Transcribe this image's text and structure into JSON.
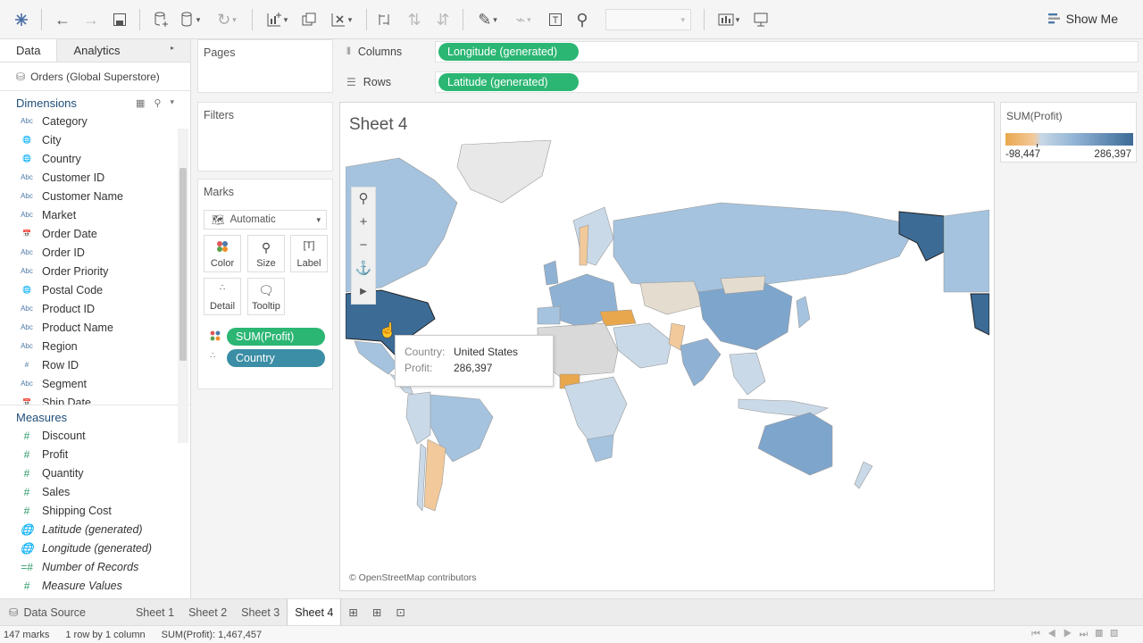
{
  "toolbar": {
    "show_me": "Show Me"
  },
  "data_pane": {
    "tab_data": "Data",
    "tab_analytics": "Analytics",
    "datasource": "Orders (Global Superstore)",
    "dimensions_title": "Dimensions",
    "dimensions": [
      "Category",
      "City",
      "Country",
      "Customer ID",
      "Customer Name",
      "Market",
      "Order Date",
      "Order ID",
      "Order Priority",
      "Postal Code",
      "Product ID",
      "Product Name",
      "Region",
      "Row ID",
      "Segment",
      "Ship Date"
    ],
    "measures_title": "Measures",
    "measures": [
      "Discount",
      "Profit",
      "Quantity",
      "Sales",
      "Shipping Cost",
      "Latitude (generated)",
      "Longitude (generated)",
      "Number of Records",
      "Measure Values"
    ]
  },
  "cards": {
    "pages": "Pages",
    "filters": "Filters",
    "marks": "Marks",
    "mark_type": "Automatic",
    "buttons": [
      "Color",
      "Size",
      "Label",
      "Detail",
      "Tooltip"
    ],
    "pill_profit": "SUM(Profit)",
    "pill_country": "Country"
  },
  "shelves": {
    "columns_label": "Columns",
    "columns_pill": "Longitude (generated)",
    "rows_label": "Rows",
    "rows_pill": "Latitude (generated)"
  },
  "view": {
    "title": "Sheet 4",
    "attribution": "© OpenStreetMap contributors",
    "tooltip_country_key": "Country:",
    "tooltip_country_val": "United States",
    "tooltip_profit_key": "Profit:",
    "tooltip_profit_val": "286,397"
  },
  "legend": {
    "title": "SUM(Profit)",
    "min": "-98,447",
    "max": "286,397",
    "colors": [
      "#e9a74d",
      "#c7d7e6",
      "#3c6b96"
    ]
  },
  "sheet_tabs": {
    "data_source": "Data Source",
    "tabs": [
      "Sheet 1",
      "Sheet 2",
      "Sheet 3",
      "Sheet 4"
    ]
  },
  "status": {
    "marks": "147 marks",
    "dims": "1 row by 1 column",
    "sum": "SUM(Profit): 1,467,457"
  }
}
